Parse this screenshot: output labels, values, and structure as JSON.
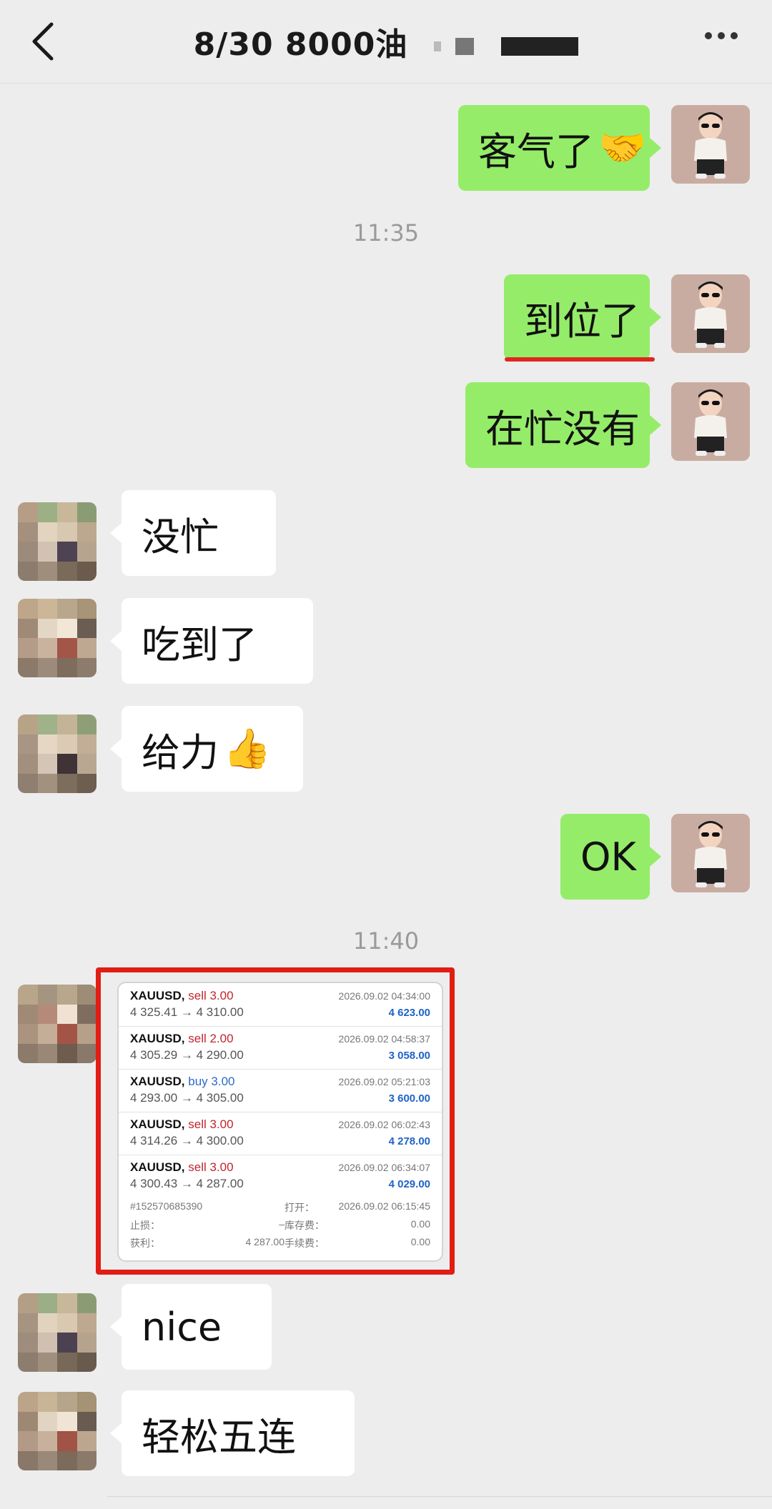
{
  "header": {
    "title": "8/30  8000油"
  },
  "colors": {
    "bubble_me": "#95ec69",
    "bubble_them": "#ffffff",
    "background": "#ededed",
    "highlight": "#e11d14"
  },
  "messages": {
    "m1": {
      "text": "客气了",
      "emoji": "🤝"
    },
    "t1": "11:35",
    "m2": {
      "text": "到位了"
    },
    "m3": {
      "text": "在忙没有"
    },
    "m4": {
      "text": "没忙"
    },
    "m5": {
      "text": "吃到了"
    },
    "m6": {
      "text": "给力",
      "emoji": "👍"
    },
    "m7": {
      "text": "OK"
    },
    "t2": "11:40",
    "m8": {
      "text": "nice"
    },
    "m9": {
      "text": "轻松五连"
    }
  },
  "trade_card": {
    "trades": [
      {
        "symbol": "XAUUSD,",
        "side": "sell",
        "volume": "3.00",
        "prices": "4 325.41 → 4 310.00",
        "time": "2026.09.02 04:34:00",
        "profit": "4 623.00"
      },
      {
        "symbol": "XAUUSD,",
        "side": "sell",
        "volume": "2.00",
        "prices": "4 305.29 → 4 290.00",
        "time": "2026.09.02 04:58:37",
        "profit": "3 058.00"
      },
      {
        "symbol": "XAUUSD,",
        "side": "buy",
        "volume": "3.00",
        "prices": "4 293.00 → 4 305.00",
        "time": "2026.09.02 05:21:03",
        "profit": "3 600.00"
      },
      {
        "symbol": "XAUUSD,",
        "side": "sell",
        "volume": "3.00",
        "prices": "4 314.26 → 4 300.00",
        "time": "2026.09.02 06:02:43",
        "profit": "4 278.00"
      },
      {
        "symbol": "XAUUSD,",
        "side": "sell",
        "volume": "3.00",
        "prices": "4 300.43 → 4 287.00",
        "time": "2026.09.02 06:34:07",
        "profit": "4 029.00"
      }
    ],
    "details": {
      "order_id": "#152570685390",
      "open_label": "打开：",
      "open_value": "2026.09.02 06:15:45",
      "sl_label": "止损：",
      "sl_value": "–",
      "swap_label": "库存费：",
      "swap_value": "0.00",
      "tp_label": "获利：",
      "tp_value": "4 287.00",
      "fee_label": "手续费：",
      "fee_value": "0.00"
    }
  }
}
